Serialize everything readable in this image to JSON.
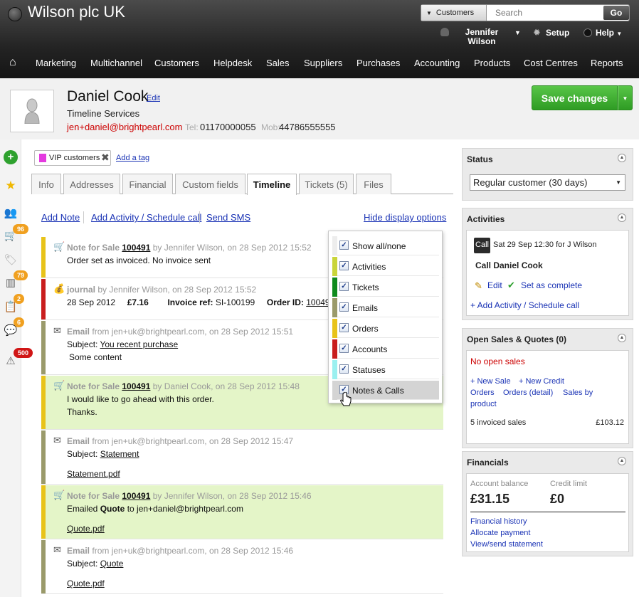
{
  "app": {
    "title": "Wilson plc UK"
  },
  "search": {
    "scope": "Customers",
    "placeholder": "Search",
    "go": "Go"
  },
  "user": {
    "name": "Jennifer\nWilson",
    "setup": "Setup",
    "help": "Help"
  },
  "nav": [
    "Marketing",
    "Multichannel",
    "Customers",
    "Helpdesk",
    "Sales",
    "Suppliers",
    "Purchases",
    "Accounting",
    "Products",
    "Cost Centres",
    "Reports"
  ],
  "customer": {
    "name": "Daniel Cook",
    "edit": "Edit",
    "company": "Timeline Services",
    "email": "jen+daniel@brightpearl.com",
    "tel_label": "Tel:",
    "tel": "01170000055",
    "mob_label": "Mob:",
    "mob": "44786555555"
  },
  "save": {
    "label": "Save changes"
  },
  "rail": {
    "badges": [
      "96",
      "79",
      "2",
      "6",
      "500"
    ]
  },
  "tags": {
    "chip": "VIP customers",
    "add": "Add a tag"
  },
  "tabs": [
    "Info",
    "Addresses",
    "Financial",
    "Custom fields",
    "Timeline",
    "Tickets (5)",
    "Files"
  ],
  "actions": {
    "add_note": "Add Note",
    "add_activity": "Add Activity / Schedule call",
    "send_sms": "Send SMS",
    "hide": "Hide display options"
  },
  "filters": [
    "Show all/none",
    "Activities",
    "Tickets",
    "Emails",
    "Orders",
    "Accounts",
    "Statuses",
    "Notes & Calls"
  ],
  "filter_colors": [
    "#ededed",
    "#c9d53a",
    "#0e8a1d",
    "#9a9a6a",
    "#e8c31a",
    "#c91e1e",
    "#9af0f0",
    "#d4d4d4"
  ],
  "timeline": [
    {
      "type": "Note for Sale",
      "ref": "100491",
      "by": "by Jennifer Wilson, on 28 Sep 2012 15:52",
      "lines": [
        "Order set as invoiced. No invoice sent"
      ]
    },
    {
      "type": "journal",
      "by": "by Jennifer Wilson, on 28 Sep 2012 15:52",
      "date": "28 Sep 2012",
      "amount": "£7.16",
      "inv_label": "Invoice ref:",
      "inv": "SI-100199",
      "order_label": "Order ID:",
      "order": "100491"
    },
    {
      "type": "Email",
      "by": "from jen+uk@brightpearl.com, on 28 Sep 2012 15:51",
      "subject_label": "Subject:",
      "subject": "You recent purchase",
      "body": "Some content"
    },
    {
      "type": "Note for Sale",
      "ref": "100491",
      "by": "by Daniel Cook, on 28 Sep 2012 15:48",
      "lines": [
        "I would like to go ahead with this order.",
        "Thanks."
      ]
    },
    {
      "type": "Email",
      "by": "from jen+uk@brightpearl.com, on 28 Sep 2012 15:47",
      "subject_label": "Subject:",
      "subject": "Statement",
      "attachment": "Statement.pdf"
    },
    {
      "type": "Note for Sale",
      "ref": "100491",
      "by": "by Jennifer Wilson, on 28 Sep 2012 15:46",
      "pre": "Emailed ",
      "bold": "Quote",
      "post": " to jen+daniel@brightpearl.com",
      "attachment": "Quote.pdf"
    },
    {
      "type": "Email",
      "by": "from jen+uk@brightpearl.com, on 28 Sep 2012 15:46",
      "subject_label": "Subject:",
      "subject": "Quote",
      "attachment": "Quote.pdf"
    }
  ],
  "status": {
    "title": "Status",
    "value": "Regular customer (30 days)"
  },
  "activities": {
    "title": "Activities",
    "badge": "Call",
    "when": "Sat 29 Sep 12:30 for J Wilson",
    "name": "Call Daniel Cook",
    "edit": "Edit",
    "complete": "Set as complete",
    "add": "+ Add Activity / Schedule call"
  },
  "sales": {
    "title": "Open Sales & Quotes (0)",
    "none": "No open sales",
    "new_sale": "+ New Sale",
    "new_credit": "+ New Credit",
    "orders": "Orders",
    "orders_detail": "Orders (detail)",
    "by_product_1": "Sales by",
    "by_product_2": "product",
    "invoiced": "5 invoiced sales",
    "invoiced_total": "£103.12"
  },
  "financials": {
    "title": "Financials",
    "balance_label": "Account balance",
    "balance": "£31.15",
    "credit_label": "Credit limit",
    "credit": "£0",
    "history": "Financial history",
    "allocate": "Allocate payment",
    "statement": "View/send statement"
  }
}
